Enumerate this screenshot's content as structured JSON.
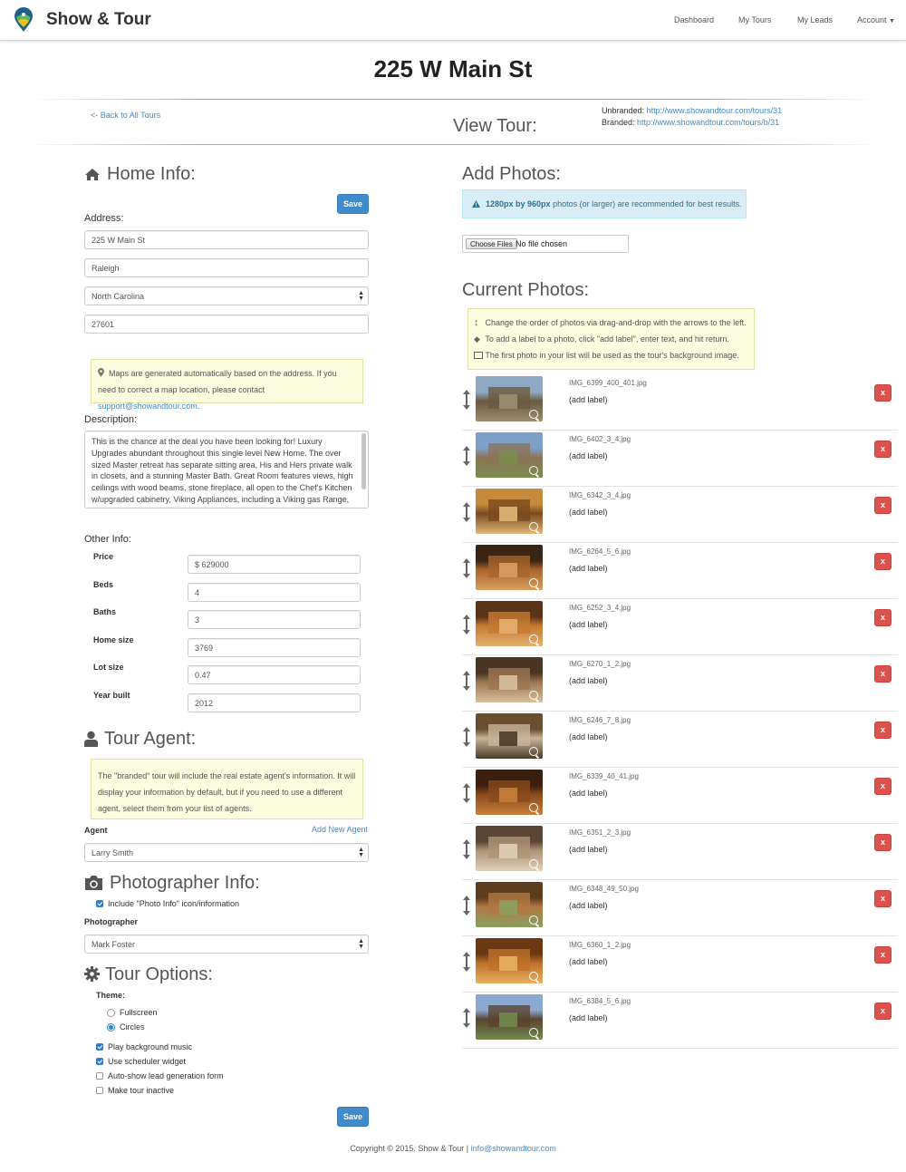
{
  "nav": {
    "brand": "Show & Tour",
    "items": [
      "Dashboard",
      "My Tours",
      "My Leads",
      "Account"
    ]
  },
  "page": {
    "title": "225 W Main St",
    "back_link": "<- Back to All Tours",
    "view_tour": "View Tour:",
    "unbranded_label": "Unbranded:",
    "unbranded_url": "http://www.showandtour.com/tours/31",
    "branded_label": "Branded:",
    "branded_url": "http://www.showandtour.com/tours/b/31"
  },
  "home_info": {
    "heading": "Home Info:",
    "save_label": "Save",
    "address_label": "Address:",
    "street": "225 W Main St",
    "city": "Raleigh",
    "state": "North Carolina",
    "zip": "27601",
    "map_note": "Maps are generated automatically based on the address. If you need to correct a map location, please contact",
    "support_email": "support@showandtour.com",
    "description_label": "Description:",
    "description": "This is the chance at the deal you have been looking for! Luxury Upgrades abundant throughout this single level New Home. The over sized Master retreat has separate sitting area, His and Hers private walk in closets, and a stunning Master Bath. Great Room features views, high ceilings with wood beams, stone fireplace, all open to the Chef's Kitchen w/upgraded cabinetry, Viking Appliances, including a Viking gas Range,",
    "other_info_label": "Other Info:",
    "fields": [
      {
        "label": "Price",
        "value": "629000",
        "prefix": "$"
      },
      {
        "label": "Beds",
        "value": "4",
        "prefix": ""
      },
      {
        "label": "Baths",
        "value": "3",
        "prefix": ""
      },
      {
        "label": "Home size",
        "value": "3769",
        "prefix": ""
      },
      {
        "label": "Lot size",
        "value": "0.47",
        "prefix": ""
      },
      {
        "label": "Year built",
        "value": "2012",
        "prefix": ""
      }
    ]
  },
  "tour_agent": {
    "heading": "Tour Agent:",
    "note": "The \"branded\" tour will include the real estate agent's information. It will display your information by default, but if you need to use a different agent, select them from your list of agents.",
    "agent_label": "Agent",
    "add_new": "Add New Agent",
    "agent": "Larry Smith"
  },
  "photographer": {
    "heading": "Photographer Info:",
    "include_label": "Include \"Photo Info\" icon/information",
    "photographer_label": "Photographer",
    "photographer": "Mark Foster"
  },
  "tour_options": {
    "heading": "Tour Options:",
    "theme_label": "Theme:",
    "themes": [
      {
        "label": "Fullscreen",
        "selected": false
      },
      {
        "label": "Circles",
        "selected": true
      }
    ],
    "options": [
      {
        "label": "Play background music",
        "checked": true
      },
      {
        "label": "Use scheduler widget",
        "checked": true
      },
      {
        "label": "Auto-show lead generation form",
        "checked": false
      },
      {
        "label": "Make tour inactive",
        "checked": false
      }
    ],
    "save_label": "Save"
  },
  "add_photos": {
    "heading": "Add Photos:",
    "recommend_bold": "1280px by 960px",
    "recommend_rest": "photos (or larger) are recommended for best results.",
    "choose_files": "Choose Files",
    "no_file": "No file chosen"
  },
  "current_photos": {
    "heading": "Current Photos:",
    "tips": [
      "Change the order of photos via drag-and-drop with the arrows to the left.",
      "To add a label to a photo, click \"add label\", enter text, and hit return.",
      "The first photo in your list will be used as the tour's background image."
    ],
    "add_label": "(add label)",
    "remove_label": "x",
    "photos": [
      {
        "file": "IMG_6399_400_401.jpg",
        "colors": [
          "#8fa9c4",
          "#6b5a40",
          "#9b8e6e"
        ]
      },
      {
        "file": "IMG_6402_3_4.jpg",
        "colors": [
          "#7e9fc8",
          "#8c7458",
          "#7a8d4e"
        ]
      },
      {
        "file": "IMG_6342_3_4.jpg",
        "colors": [
          "#c58a3c",
          "#7a4a1e",
          "#e0b878"
        ]
      },
      {
        "file": "IMG_6264_5_6.jpg",
        "colors": [
          "#3a2414",
          "#a8652a",
          "#d9a060"
        ]
      },
      {
        "file": "IMG_6252_3_4.jpg",
        "colors": [
          "#5a3418",
          "#c47a30",
          "#e6b070"
        ]
      },
      {
        "file": "IMG_6270_1_2.jpg",
        "colors": [
          "#4a3422",
          "#9c7650",
          "#d8c0a0"
        ]
      },
      {
        "file": "IMG_6246_7_8.jpg",
        "colors": [
          "#6a4e30",
          "#c8b498",
          "#4a3a28"
        ]
      },
      {
        "file": "IMG_6339_40_41.jpg",
        "colors": [
          "#3a1e0e",
          "#8a4a1c",
          "#c8803a"
        ]
      },
      {
        "file": "IMG_6351_2_3.jpg",
        "colors": [
          "#5a4634",
          "#b09478",
          "#e0d0b8"
        ]
      },
      {
        "file": "IMG_6348_49_50.jpg",
        "colors": [
          "#5e3c1e",
          "#b07844",
          "#8aa060"
        ]
      },
      {
        "file": "IMG_6360_1_2.jpg",
        "colors": [
          "#6a3812",
          "#c0702a",
          "#e8b060"
        ]
      },
      {
        "file": "IMG_6384_5_6.jpg",
        "colors": [
          "#8aa8d0",
          "#5a4430",
          "#708a4c"
        ]
      }
    ]
  },
  "footer": {
    "copyright": "Copyright © 2015. Show & Tour |",
    "email": "info@showandtour.com"
  }
}
